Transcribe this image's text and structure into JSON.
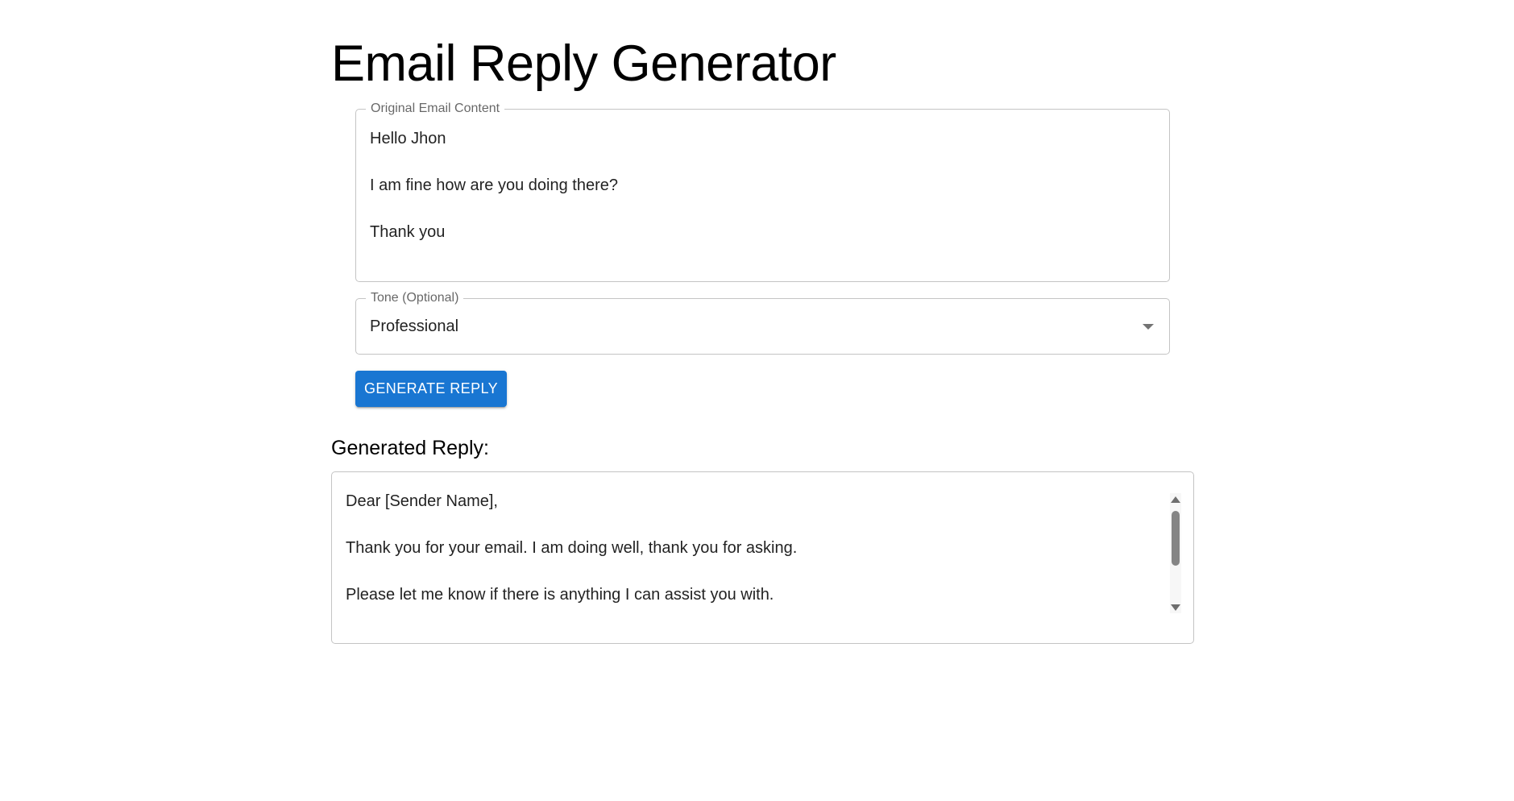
{
  "header": {
    "title": "Email Reply Generator"
  },
  "email_input": {
    "label": "Original Email Content",
    "value": "Hello Jhon\n\nI am fine how are you doing there?\n\nThank you"
  },
  "tone_select": {
    "label": "Tone (Optional)",
    "selected": "Professional",
    "icon": "arrow-drop-down-icon"
  },
  "generate_button": {
    "label": "Generate Reply",
    "color": "#1976d2"
  },
  "reply": {
    "heading": "Generated Reply:",
    "value": "Dear [Sender Name],\n\nThank you for your email. I am doing well, thank you for asking.\n\nPlease let me know if there is anything I can assist you with."
  }
}
